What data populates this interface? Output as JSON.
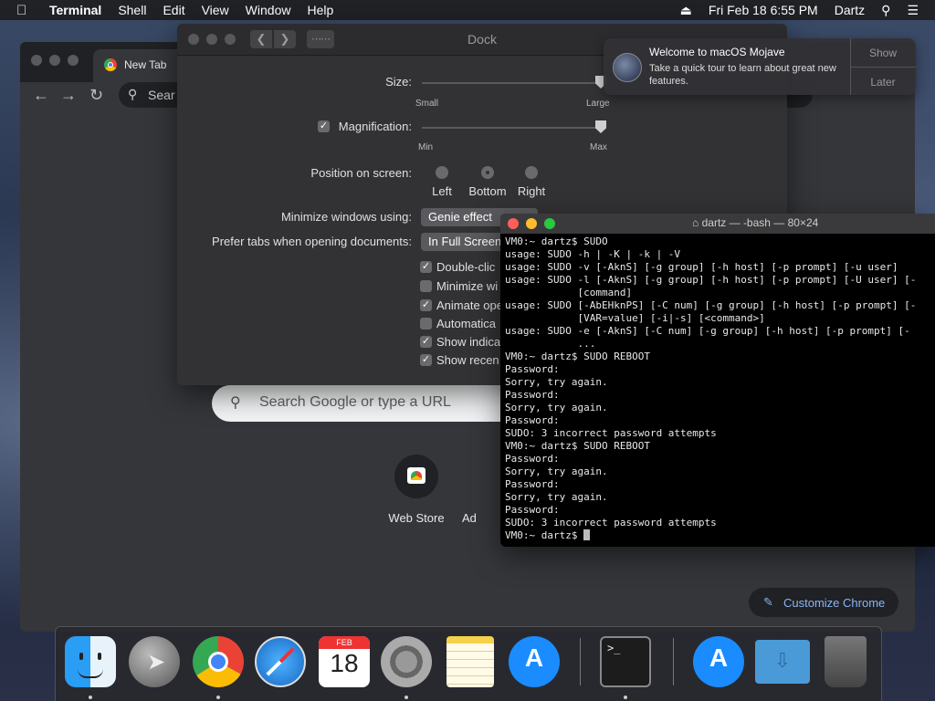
{
  "menubar": {
    "app": "Terminal",
    "items": [
      "Shell",
      "Edit",
      "View",
      "Window",
      "Help"
    ],
    "datetime": "Fri Feb 18  6:55 PM",
    "user": "Dartz"
  },
  "chrome": {
    "tab_title": "New Tab",
    "omnibox_placeholder": "Sear",
    "search_placeholder": "Search Google or type a URL",
    "shortcuts": [
      "Web Store",
      "Ad"
    ],
    "customize": "Customize Chrome"
  },
  "dockprefs": {
    "title": "Dock",
    "size_label": "Size:",
    "size_min": "Small",
    "size_max": "Large",
    "magnification_label": "Magnification:",
    "mag_min": "Min",
    "mag_max": "Max",
    "position_label": "Position on screen:",
    "positions": [
      "Left",
      "Bottom",
      "Right"
    ],
    "position_selected": "Bottom",
    "minimize_label": "Minimize windows using:",
    "minimize_value": "Genie effect",
    "tabs_label": "Prefer tabs when opening documents:",
    "tabs_value": "In Full Screen",
    "checkboxes": [
      {
        "label": "Double-clic",
        "checked": true
      },
      {
        "label": "Minimize wi",
        "checked": false
      },
      {
        "label": "Animate ope",
        "checked": true
      },
      {
        "label": "Automatica",
        "checked": false
      },
      {
        "label": "Show indica",
        "checked": true
      },
      {
        "label": "Show recen",
        "checked": true
      }
    ],
    "size_level": 1.0,
    "magnification_level": 1.0
  },
  "notification": {
    "title": "Welcome to macOS Mojave",
    "body": "Take a quick tour to learn about great new features.",
    "action_show": "Show",
    "action_later": "Later"
  },
  "terminal": {
    "title": "dartz — -bash — 80×24",
    "lines": [
      "VM0:~ dartz$ SUDO",
      "usage: SUDO -h | -K | -k | -V",
      "usage: SUDO -v [-AknS] [-g group] [-h host] [-p prompt] [-u user]",
      "usage: SUDO -l [-AknS] [-g group] [-h host] [-p prompt] [-U user] [-",
      "            [command]",
      "usage: SUDO [-AbEHknPS] [-C num] [-g group] [-h host] [-p prompt] [-",
      "            [VAR=value] [-i|-s] [<command>]",
      "usage: SUDO -e [-AknS] [-C num] [-g group] [-h host] [-p prompt] [-",
      "            ...",
      "VM0:~ dartz$ SUDO REBOOT",
      "Password:",
      "Sorry, try again.",
      "Password:",
      "Sorry, try again.",
      "Password:",
      "SUDO: 3 incorrect password attempts",
      "VM0:~ dartz$ SUDO REBOOT",
      "Password:",
      "Sorry, try again.",
      "Password:",
      "Sorry, try again.",
      "Password:",
      "SUDO: 3 incorrect password attempts",
      "VM0:~ dartz$ "
    ]
  },
  "calendar_icon": {
    "month": "FEB",
    "day": "18"
  },
  "terminal_icon_text": ">_"
}
